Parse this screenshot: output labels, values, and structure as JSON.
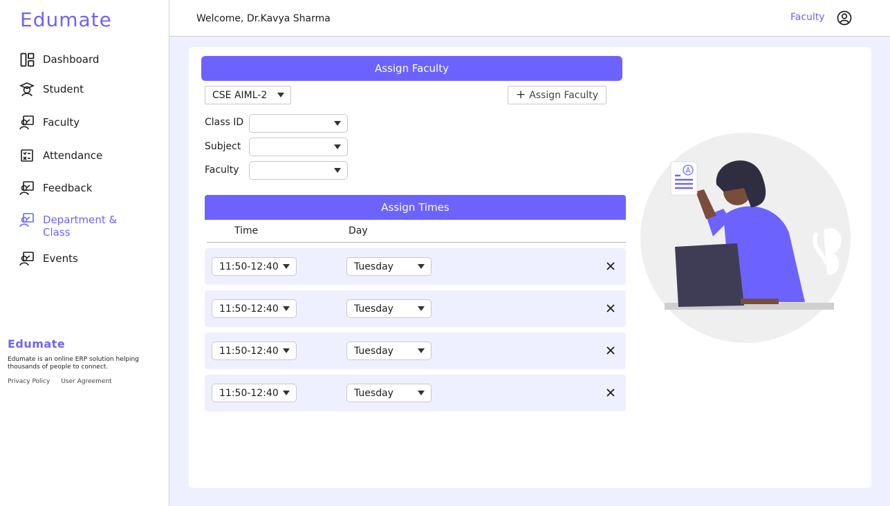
{
  "brand": "Edumate",
  "sidebar": {
    "items": [
      {
        "label": "Dashboard",
        "icon": "dashboard-icon"
      },
      {
        "label": "Student",
        "icon": "student-icon"
      },
      {
        "label": "Faculty",
        "icon": "faculty-icon"
      },
      {
        "label": "Attendance",
        "icon": "attendance-icon"
      },
      {
        "label": "Feedback",
        "icon": "feedback-icon"
      },
      {
        "label": "Department & Class",
        "icon": "department-icon"
      },
      {
        "label": "Events",
        "icon": "events-icon"
      }
    ],
    "footer": {
      "brand": "Edumate",
      "description": "Edumate is an online ERP solution helping thousands of people to connect.",
      "privacy": "Privacy Policy",
      "agreement": "User Agreement"
    }
  },
  "topbar": {
    "welcome": "Welcome, Dr.Kavya Sharma",
    "role": "Faculty"
  },
  "assign": {
    "title": "Assign Faculty",
    "department": "CSE AIML-2",
    "add_button": "Assign Faculty",
    "fields": {
      "class_id_label": "Class ID",
      "subject_label": "Subject",
      "faculty_label": "Faculty"
    }
  },
  "times": {
    "title": "Assign Times",
    "col_time": "Time",
    "col_day": "Day",
    "rows": [
      {
        "time": "11:50-12:40",
        "day": "Tuesday"
      },
      {
        "time": "11:50-12:40",
        "day": "Tuesday"
      },
      {
        "time": "11:50-12:40",
        "day": "Tuesday"
      },
      {
        "time": "11:50-12:40",
        "day": "Tuesday"
      }
    ]
  },
  "colors": {
    "accent": "#6c63ff",
    "background": "#eef0ff"
  }
}
